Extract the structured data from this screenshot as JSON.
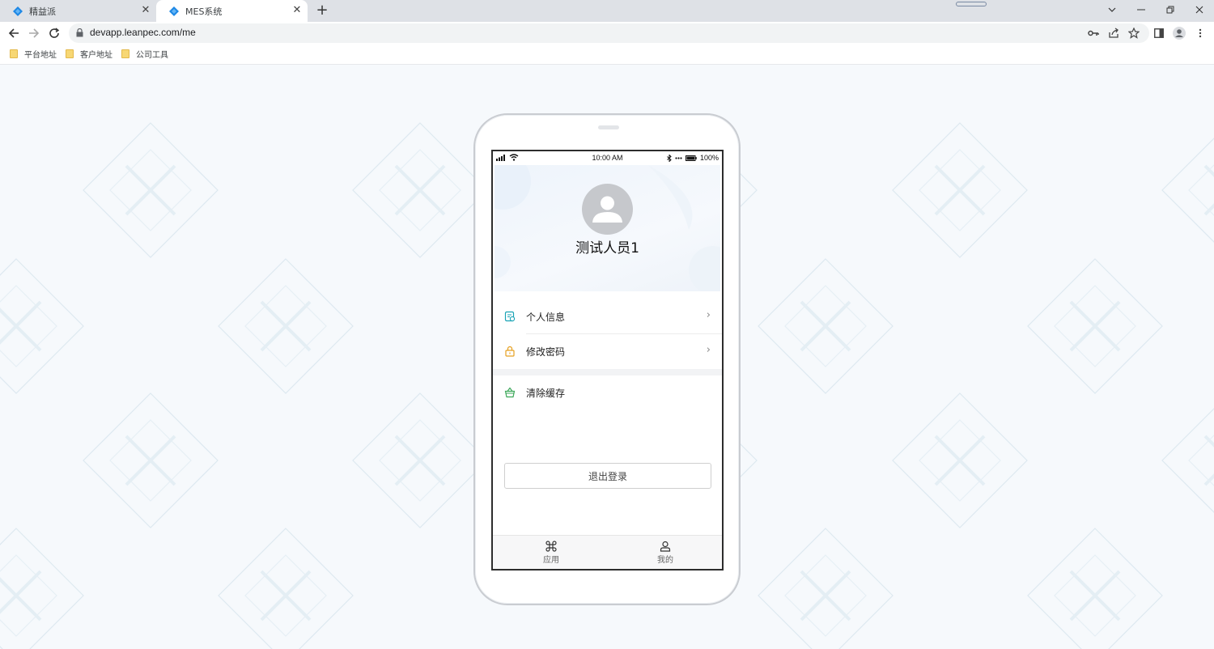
{
  "browser": {
    "tabs": [
      {
        "title": "精益派",
        "active": false
      },
      {
        "title": "MES系统",
        "active": true
      }
    ],
    "address_url": "devapp.leanpec.com/me",
    "bookmarks": [
      "平台地址",
      "客户地址",
      "公司工具"
    ]
  },
  "colors": {
    "tab_active": "#ffffff",
    "tab_bar": "#dee1e6",
    "favicon": "#1e88e5",
    "page_bg": "#f6f9fc",
    "pattern": "#dde9f0",
    "icon_info": "#1aa3b5",
    "icon_password": "#e6a020",
    "icon_cache": "#3da85a"
  },
  "phone": {
    "status": {
      "time": "10:00 AM",
      "battery": "100%"
    },
    "profile": {
      "username": "测试人员1"
    },
    "menu": [
      {
        "label": "个人信息",
        "icon": "id-card-icon",
        "has_arrow": true
      },
      {
        "label": "修改密码",
        "icon": "lock-icon",
        "has_arrow": true
      },
      {
        "label": "清除缓存",
        "icon": "basket-icon",
        "has_arrow": false
      }
    ],
    "logout_label": "退出登录",
    "tabbar": [
      {
        "label": "应用",
        "icon": "command-icon"
      },
      {
        "label": "我的",
        "icon": "user-icon"
      }
    ]
  }
}
